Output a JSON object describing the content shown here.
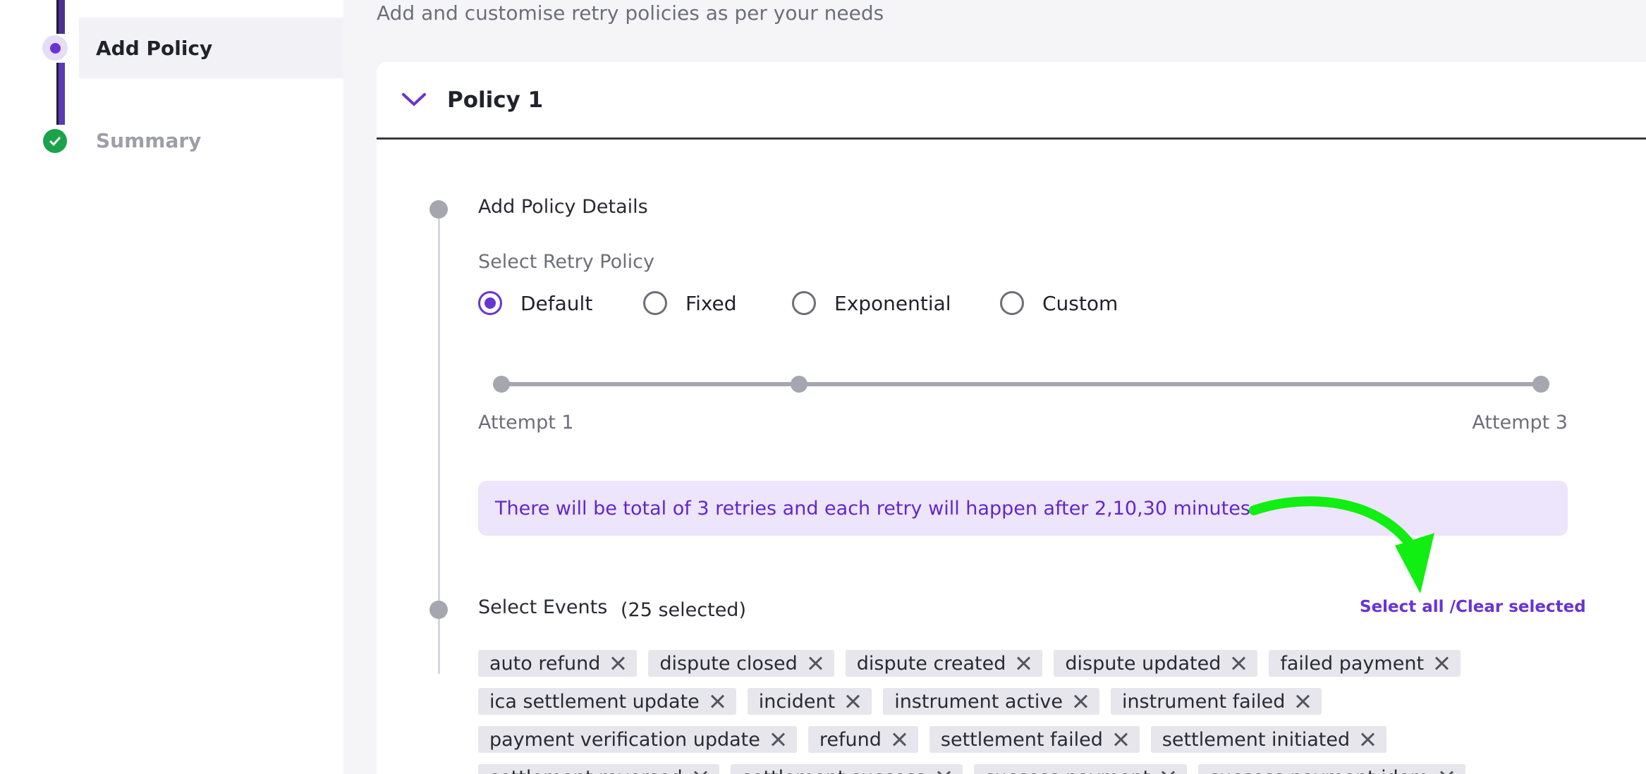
{
  "stepper": {
    "steps": [
      {
        "label": "Add Policy",
        "state": "active"
      },
      {
        "label": "Summary",
        "state": "completed"
      }
    ]
  },
  "page": {
    "subtitle": "Add and customise retry policies as per your needs"
  },
  "policy": {
    "title": "Policy 1",
    "details_title": "Add Policy Details",
    "retry_label": "Select Retry Policy",
    "options": [
      "Default",
      "Fixed",
      "Exponential",
      "Custom"
    ],
    "selected_option": "Default",
    "attempt_start": "Attempt 1",
    "attempt_end": "Attempt 3",
    "info": "There will be total of 3 retries and each retry will happen after 2,10,30 minutes",
    "events_title": "Select Events",
    "events_count": "(25 selected)",
    "select_all_label": "Select all /Clear selected",
    "events": [
      "auto refund",
      "dispute closed",
      "dispute created",
      "dispute updated",
      "failed payment",
      "ica settlement update",
      "incident",
      "instrument active",
      "instrument failed",
      "payment verification update",
      "refund",
      "settlement failed",
      "settlement initiated",
      "settlement reversed",
      "settlement success",
      "success payment",
      "success payment idem"
    ]
  },
  "colors": {
    "accent": "#6833d6",
    "success": "#1aa34a",
    "banner_bg": "#ece5fb",
    "annotation_arrow": "#11ee11"
  }
}
